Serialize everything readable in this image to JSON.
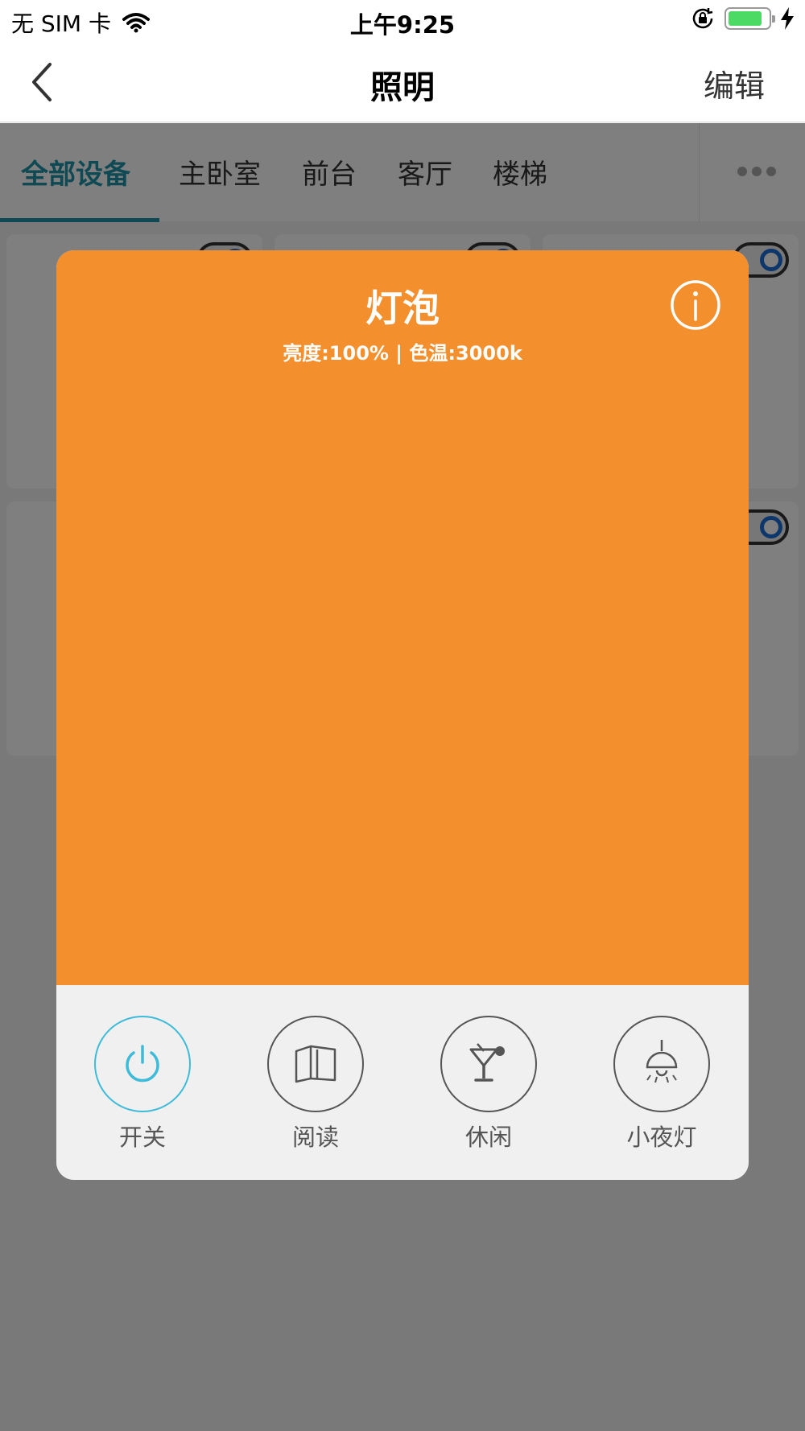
{
  "status_bar": {
    "carrier": "无 SIM 卡",
    "time": "上午9:25",
    "battery_fill_fraction": 0.85,
    "battery_color": "#4cd964"
  },
  "nav": {
    "title": "照明",
    "edit_label": "编辑",
    "back_icon": "chevron-left-icon"
  },
  "tabs": {
    "items": [
      "全部设备",
      "主卧室",
      "前台",
      "客厅",
      "楼梯"
    ],
    "active_index": 0,
    "active_color": "#1e93a6",
    "more_icon": "more-horizontal-icon"
  },
  "modal": {
    "title": "灯泡",
    "subtitle": "亮度:100% | 色温:3000k",
    "background_color": "#f48f2d",
    "info_icon": "info-icon",
    "actions": [
      {
        "label": "开关",
        "icon": "power-icon",
        "active": true
      },
      {
        "label": "阅读",
        "icon": "book-icon",
        "active": false
      },
      {
        "label": "休闲",
        "icon": "cocktail-icon",
        "active": false
      },
      {
        "label": "小夜灯",
        "icon": "ceiling-lamp-icon",
        "active": false
      }
    ],
    "active_color": "#3dbbd8"
  }
}
